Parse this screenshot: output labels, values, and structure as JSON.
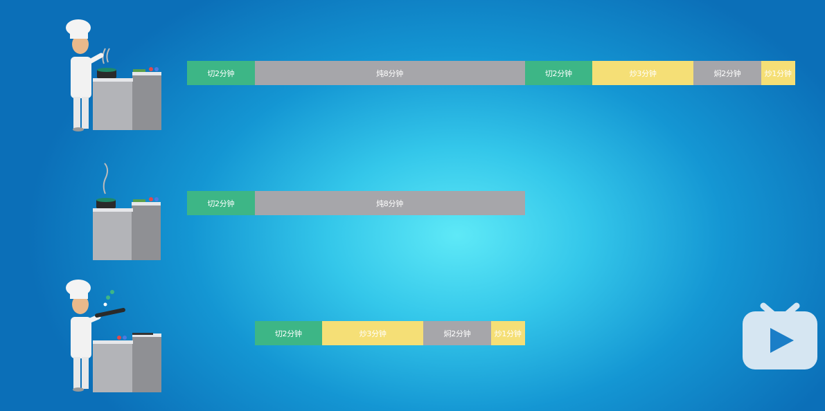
{
  "rows": [
    {
      "scene": "chef-cooking-wok",
      "segments": [
        {
          "label": "切2分钟",
          "minutes": 2,
          "color": "green"
        },
        {
          "label": "炖8分钟",
          "minutes": 8,
          "color": "gray"
        },
        {
          "label": "切2分钟",
          "minutes": 2,
          "color": "green"
        },
        {
          "label": "炒3分钟",
          "minutes": 3,
          "color": "yellow"
        },
        {
          "label": "焖2分钟",
          "minutes": 2,
          "color": "gray"
        },
        {
          "label": "炒1分钟",
          "minutes": 1,
          "color": "yellow"
        }
      ]
    },
    {
      "scene": "steaming-pot-on-counter",
      "segments": [
        {
          "label": "切2分钟",
          "minutes": 2,
          "color": "green"
        },
        {
          "label": "炖8分钟",
          "minutes": 8,
          "color": "gray"
        }
      ]
    },
    {
      "scene": "chef-tossing-pan",
      "segments": [
        {
          "label": "切2分钟",
          "minutes": 2,
          "color": "green"
        },
        {
          "label": "炒3分钟",
          "minutes": 3,
          "color": "yellow"
        },
        {
          "label": "焖2分钟",
          "minutes": 2,
          "color": "gray"
        },
        {
          "label": "炒1分钟",
          "minutes": 1,
          "color": "yellow"
        }
      ]
    }
  ],
  "colors": {
    "green": "#3db686",
    "gray": "#a6a6aa",
    "yellow": "#f5df76",
    "background_center": "#5ee9f7",
    "background_edge": "#0b6fb8"
  },
  "logo": "bilibili-tv-icon"
}
